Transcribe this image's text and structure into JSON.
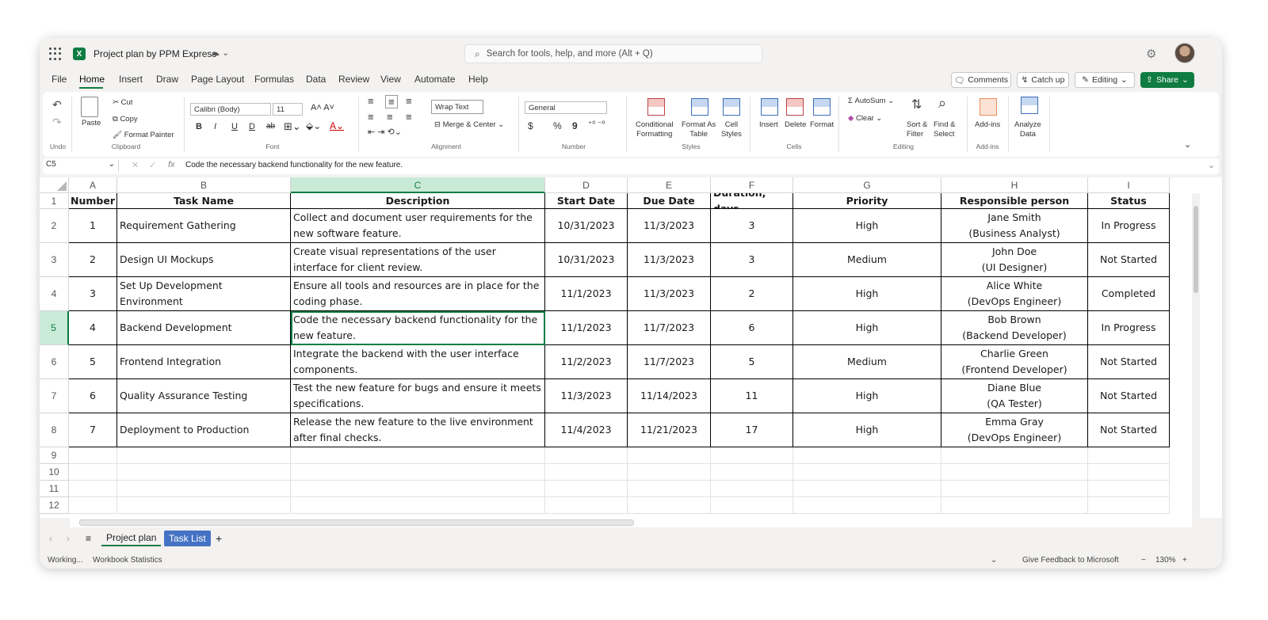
{
  "title_bar": {
    "doc_title": "Project plan by PPM Express",
    "search_placeholder": "Search for tools, help, and more (Alt + Q)",
    "app_logo": "X"
  },
  "menu": {
    "tabs": [
      "File",
      "Home",
      "Insert",
      "Draw",
      "Page Layout",
      "Formulas",
      "Data",
      "Review",
      "View",
      "Automate",
      "Help"
    ],
    "comments": "Comments",
    "catchup": "Catch up",
    "editing": "Editing",
    "share": "Share"
  },
  "ribbon": {
    "undo_group": "Undo",
    "paste": "Paste",
    "cut": "Cut",
    "copy": "Copy",
    "format_painter": "Format Painter",
    "clipboard_group": "Clipboard",
    "font_name": "Calibri (Body)",
    "font_size": "11",
    "bold": "B",
    "italic": "I",
    "underline": "U",
    "double_underline": "D",
    "strikethrough": "ab",
    "font_color_glyph": "A",
    "font_group": "Font",
    "wrap_text": "Wrap Text",
    "merge_center": "Merge & Center",
    "alignment_group": "Alignment",
    "number_format": "General",
    "currency": "$",
    "percent": "%",
    "comma": "9",
    "number_group": "Number",
    "conditional": [
      "Conditional",
      "Formatting"
    ],
    "format_as_table": [
      "Format As",
      "Table"
    ],
    "cell_styles": [
      "Cell",
      "Styles"
    ],
    "styles_group": "Styles",
    "insert": "Insert",
    "delete": "Delete",
    "format": "Format",
    "cells_group": "Cells",
    "autosum": "AutoSum",
    "clear": "Clear",
    "sort_filter": [
      "Sort &",
      "Filter"
    ],
    "find_select": [
      "Find &",
      "Select"
    ],
    "editing_group": "Editing",
    "addins": "Add-ins",
    "addins_group": "Add-ins",
    "analyze": [
      "Analyze",
      "Data"
    ]
  },
  "formula_bar": {
    "cell_ref": "C5",
    "fx": "fx",
    "content": "Code the necessary backend functionality for the new feature."
  },
  "sheet": {
    "columns": [
      "A",
      "B",
      "C",
      "D",
      "E",
      "F",
      "G",
      "H",
      "I"
    ],
    "row_numbers": [
      "1",
      "2",
      "3",
      "4",
      "5",
      "6",
      "7",
      "8",
      "9",
      "10",
      "11",
      "12"
    ],
    "headers": [
      "Number",
      "Task Name",
      "Description",
      "Start Date",
      "Due Date",
      "Duration, days",
      "Priority",
      "Responsible person",
      "Status"
    ],
    "rows": [
      [
        "1",
        "Requirement Gathering",
        "Collect and document user requirements for the new software feature.",
        "10/31/2023",
        "11/3/2023",
        "3",
        "High",
        "Jane Smith",
        "(Business Analyst)",
        "In Progress"
      ],
      [
        "2",
        "Design UI Mockups",
        "Create visual representations of the user interface for client review.",
        "10/31/2023",
        "11/3/2023",
        "3",
        "Medium",
        "John Doe",
        "(UI Designer)",
        "Not Started"
      ],
      [
        "3",
        "Set Up Development Environment",
        "Ensure all tools and resources are in place for the coding phase.",
        "11/1/2023",
        "11/3/2023",
        "2",
        "High",
        "Alice White",
        "(DevOps Engineer)",
        "Completed"
      ],
      [
        "4",
        "Backend Development",
        "Code the necessary backend functionality for the new feature.",
        "11/1/2023",
        "11/7/2023",
        "6",
        "High",
        "Bob Brown",
        "(Backend Developer)",
        "In Progress"
      ],
      [
        "5",
        "Frontend Integration",
        "Integrate the backend with the user interface components.",
        "11/2/2023",
        "11/7/2023",
        "5",
        "Medium",
        "Charlie Green",
        "(Frontend Developer)",
        "Not Started"
      ],
      [
        "6",
        "Quality Assurance Testing",
        "Test the new feature for bugs and ensure it meets specifications.",
        "11/3/2023",
        "11/14/2023",
        "11",
        "High",
        "Diane Blue",
        "(QA Tester)",
        "Not Started"
      ],
      [
        "7",
        "Deployment to Production",
        "Release the new feature to the live environment after final checks.",
        "11/4/2023",
        "11/21/2023",
        "17",
        "High",
        "Emma Gray",
        "(DevOps Engineer)",
        "Not Started"
      ]
    ],
    "selected": {
      "row": 5,
      "col": "C"
    }
  },
  "sheet_tabs": {
    "active": "Project plan",
    "other": "Task List",
    "add": "+"
  },
  "status_bar": {
    "working": "Working...",
    "stats": "Workbook Statistics",
    "feedback": "Give Feedback to Microsoft",
    "zoom": "130%"
  },
  "colors": {
    "accent": "#107c41",
    "selection_fill": "#caead8",
    "tab_blue": "#4472c4"
  }
}
